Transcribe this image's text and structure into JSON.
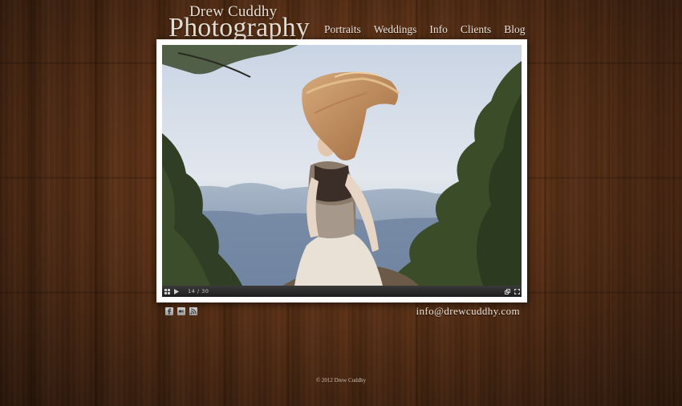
{
  "site": {
    "logo_line1": "Drew Cuddhy",
    "logo_line2": "Photography"
  },
  "nav": {
    "items": [
      {
        "label": "Portraits"
      },
      {
        "label": "Weddings"
      },
      {
        "label": "Info"
      },
      {
        "label": "Clients"
      },
      {
        "label": "Blog"
      }
    ]
  },
  "slideshow": {
    "counter": "14 / 30"
  },
  "social": {
    "icons": [
      "facebook-icon",
      "flickr-icon",
      "rss-icon"
    ]
  },
  "contact": {
    "email": "info@drewcuddhy.com"
  },
  "footer": {
    "copyright": "© 2012 Drew Cuddhy"
  },
  "colors": {
    "text": "#ece4da",
    "frame": "#ffffff",
    "player_bar": "#2a2a2a"
  }
}
